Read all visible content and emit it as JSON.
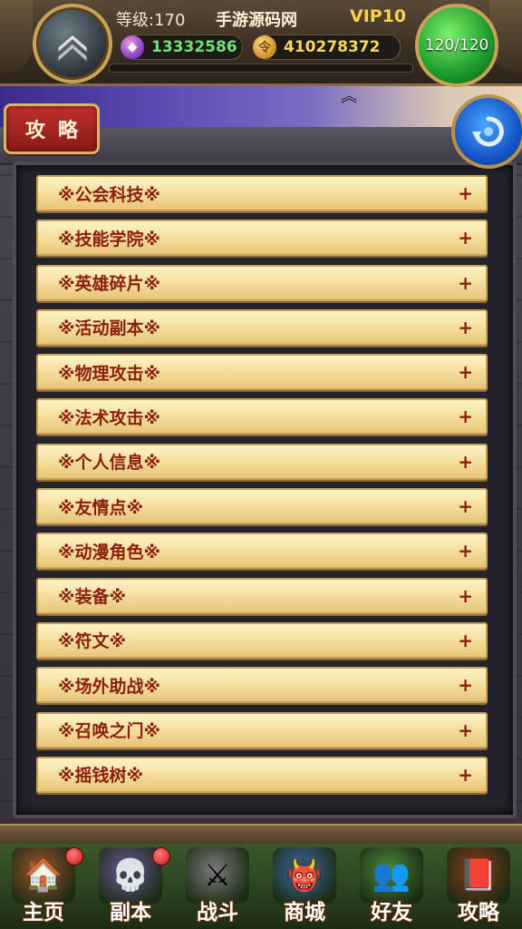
{
  "hud": {
    "level": "等级:170",
    "title": "手游源码网",
    "vip": "VIP10",
    "gems": "13332586",
    "gold": "410278372",
    "gold_icon_glyph": "令",
    "stamina": "120/120"
  },
  "guide_button": {
    "label": "攻略"
  },
  "list": {
    "items": [
      {
        "label": "※公会科技※"
      },
      {
        "label": "※技能学院※"
      },
      {
        "label": "※英雄碎片※"
      },
      {
        "label": "※活动副本※"
      },
      {
        "label": "※物理攻击※"
      },
      {
        "label": "※法术攻击※"
      },
      {
        "label": "※个人信息※"
      },
      {
        "label": "※友情点※"
      },
      {
        "label": "※动漫角色※"
      },
      {
        "label": "※装备※"
      },
      {
        "label": "※符文※"
      },
      {
        "label": "※场外助战※"
      },
      {
        "label": "※召唤之门※"
      },
      {
        "label": "※摇钱树※"
      }
    ],
    "expand_symbol": "+"
  },
  "nav": {
    "items": [
      {
        "label": "主页",
        "icon": "house-icon"
      },
      {
        "label": "副本",
        "icon": "skull-icon"
      },
      {
        "label": "战斗",
        "icon": "sword-icon"
      },
      {
        "label": "商城",
        "icon": "monster-icon"
      },
      {
        "label": "好友",
        "icon": "friends-icon"
      },
      {
        "label": "攻略",
        "icon": "book-icon"
      }
    ]
  },
  "colors": {
    "list_text": "#8c2010",
    "gem_value": "#70e07a",
    "gold_value": "#f6d85a",
    "vip": "#f8d24c"
  }
}
